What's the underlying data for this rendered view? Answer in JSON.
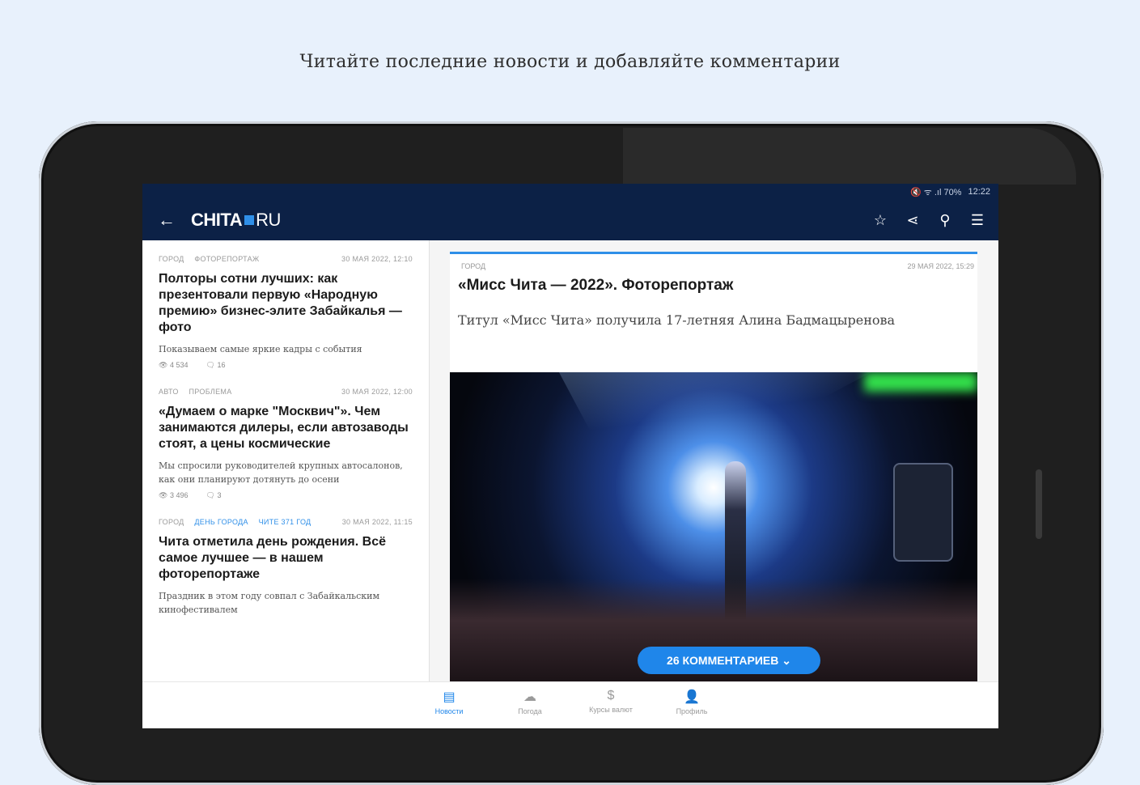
{
  "caption": "Читайте последние новости и добавляйте комментарии",
  "statusbar": {
    "icons": "🔇 ᯤ .ıl 70%",
    "time": "12:22"
  },
  "appbar": {
    "back_icon": "arrow-left-icon",
    "logo_main": "CHITA",
    "logo_ru": "RU",
    "actions": [
      "star-icon",
      "share-icon",
      "search-icon",
      "menu-icon"
    ]
  },
  "feed": [
    {
      "tags": [
        "ГОРОД",
        "ФОТОРЕПОРТАЖ"
      ],
      "date": "30 МАЯ 2022, 12:10",
      "title": "Полторы сотни лучших: как презентовали первую «Народную премию» бизнес-элите Забайкалья — фото",
      "subtitle": "Показываем самые яркие кадры с события",
      "views": "4 534",
      "comments": "16"
    },
    {
      "tags": [
        "АВТО",
        "ПРОБЛЕМА"
      ],
      "date": "30 МАЯ 2022, 12:00",
      "title": "«Думаем о марке \"Москвич\"». Чем занимаются дилеры, если автозаводы стоят, а цены космические",
      "subtitle": "Мы спросили руководителей крупных автосалонов, как они планируют дотянуть до осени",
      "views": "3 496",
      "comments": "3"
    },
    {
      "tags": [
        "ГОРОД"
      ],
      "highlight_tags": [
        "ДЕНЬ ГОРОДА",
        "ЧИТЕ 371 ГОД"
      ],
      "date": "30 МАЯ 2022, 11:15",
      "title": "Чита отметила день рождения. Всё самое лучшее — в нашем фоторепортаже",
      "subtitle": "Праздник в этом году совпал с Забайкальским кинофестивалем"
    }
  ],
  "article": {
    "tag": "ГОРОД",
    "date": "29 МАЯ 2022, 15:29",
    "title": "«Мисс Чита — 2022». Фоторепортаж",
    "lead": "Титул «Мисс Чита» получила 17-летняя Алина Бадмацыренова",
    "comments_button": "26 КОММЕНТАРИЕВ ⌄"
  },
  "bottomnav": [
    {
      "label": "Новости",
      "icon": "newspaper-icon",
      "active": true
    },
    {
      "label": "Погода",
      "icon": "cloud-icon",
      "active": false
    },
    {
      "label": "Курсы валют",
      "icon": "currency-icon",
      "active": false
    },
    {
      "label": "Профиль",
      "icon": "user-icon",
      "active": false
    }
  ],
  "colors": {
    "appbar": "#0c2146",
    "accent": "#1f86ea",
    "background": "#e8f1fc"
  }
}
